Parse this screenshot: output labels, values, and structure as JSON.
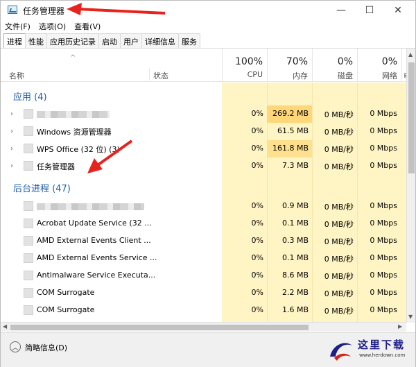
{
  "window": {
    "title": "任务管理器",
    "controls": {
      "minimize": "—",
      "maximize": "☐",
      "close": "✕"
    }
  },
  "menu": [
    "文件(F)",
    "选项(O)",
    "查看(V)"
  ],
  "tabs": [
    "进程",
    "性能",
    "应用历史记录",
    "启动",
    "用户",
    "详细信息",
    "服务"
  ],
  "active_tab": "进程",
  "header": {
    "sort_arrow": "^",
    "name": "名称",
    "status": "状态",
    "cpu": {
      "pct": "100%",
      "label": "CPU"
    },
    "mem": {
      "pct": "70%",
      "label": "内存"
    },
    "disk": {
      "pct": "0%",
      "label": "磁盘"
    },
    "net": {
      "pct": "0%",
      "label": "网络"
    },
    "power_partial": "电"
  },
  "groups": {
    "apps": {
      "title": "应用 (4)",
      "rows": [
        {
          "name": "",
          "cpu": "0%",
          "mem": "269.2 MB",
          "disk": "0 MB/秒",
          "net": "0 Mbps"
        },
        {
          "name": "Windows 资源管理器",
          "cpu": "0%",
          "mem": "61.5 MB",
          "disk": "0 MB/秒",
          "net": "0 Mbps"
        },
        {
          "name": "WPS Office (32 位) (3)",
          "cpu": "0%",
          "mem": "161.8 MB",
          "disk": "0 MB/秒",
          "net": "0 Mbps"
        },
        {
          "name": "任务管理器",
          "cpu": "0%",
          "mem": "7.3 MB",
          "disk": "0 MB/秒",
          "net": "0 Mbps"
        }
      ]
    },
    "background": {
      "title": "后台进程 (47)",
      "rows": [
        {
          "name": "",
          "cpu": "0%",
          "mem": "0.9 MB",
          "disk": "0 MB/秒",
          "net": "0 Mbps"
        },
        {
          "name": "Acrobat Update Service (32 ...",
          "cpu": "0%",
          "mem": "0.1 MB",
          "disk": "0 MB/秒",
          "net": "0 Mbps"
        },
        {
          "name": "AMD External Events Client ...",
          "cpu": "0%",
          "mem": "0.3 MB",
          "disk": "0 MB/秒",
          "net": "0 Mbps"
        },
        {
          "name": "AMD External Events Service ...",
          "cpu": "0%",
          "mem": "0.1 MB",
          "disk": "0 MB/秒",
          "net": "0 Mbps"
        },
        {
          "name": "Antimalware Service Executa...",
          "cpu": "0%",
          "mem": "8.6 MB",
          "disk": "0 MB/秒",
          "net": "0 Mbps"
        },
        {
          "name": "COM Surrogate",
          "cpu": "0%",
          "mem": "2.2 MB",
          "disk": "0 MB/秒",
          "net": "0 Mbps"
        },
        {
          "name": "COM Surrogate",
          "cpu": "0%",
          "mem": "1.6 MB",
          "disk": "0 MB/秒",
          "net": "0 Mbps"
        }
      ]
    }
  },
  "footer": {
    "label": "简略信息(D)"
  },
  "watermark": {
    "text": "这里下载",
    "sub": "www.herdown.com"
  },
  "colors": {
    "group_title": "#1e5fa8",
    "column_highlight": "#fff4c4",
    "memory_highlight": "#ffd77a",
    "annotation_arrow": "#e8231d"
  }
}
